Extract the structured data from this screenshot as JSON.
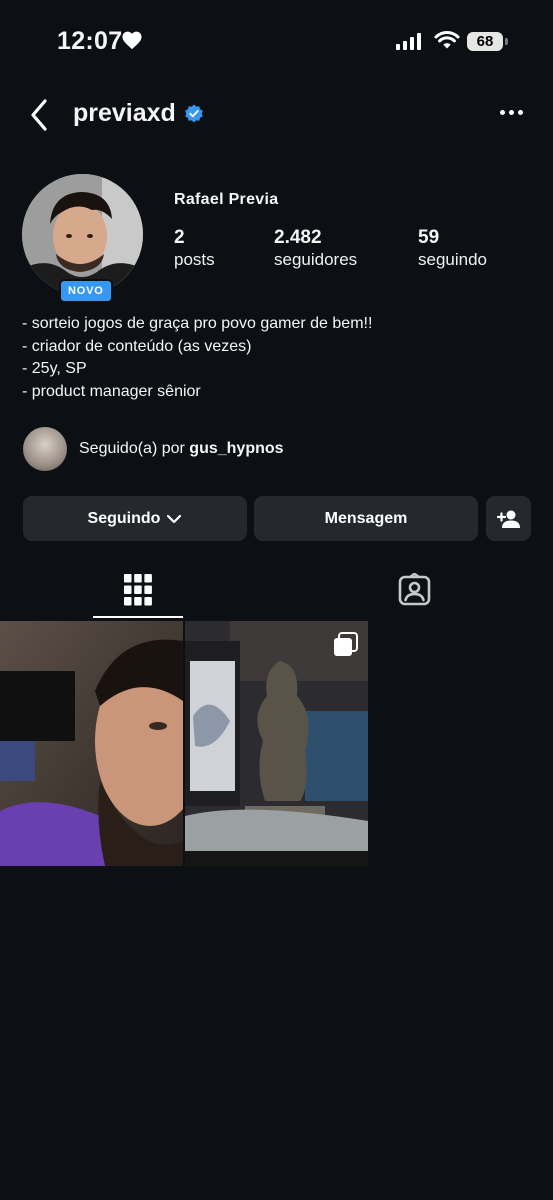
{
  "status_bar": {
    "time": "12:07",
    "battery": "68"
  },
  "header": {
    "username": "previaxd"
  },
  "profile": {
    "badge": "NOVO",
    "full_name": "Rafael Previa",
    "stats": [
      {
        "value": "2",
        "label": "posts"
      },
      {
        "value": "2.482",
        "label": "seguidores"
      },
      {
        "value": "59",
        "label": "seguindo"
      }
    ],
    "bio": [
      "- sorteio jogos de graça pro povo gamer de bem!!",
      "- criador de conteúdo (as vezes)",
      "- 25y, SP",
      "- product manager sênior"
    ],
    "followed_by_prefix": "Seguido(a) por",
    "followed_by_user": "gus_hypnos"
  },
  "buttons": {
    "following": "Seguindo",
    "message": "Mensagem"
  },
  "colors": {
    "background": "#0c1014",
    "button": "#25292e",
    "badge": "#3897f0",
    "verified": "#3897f0"
  }
}
